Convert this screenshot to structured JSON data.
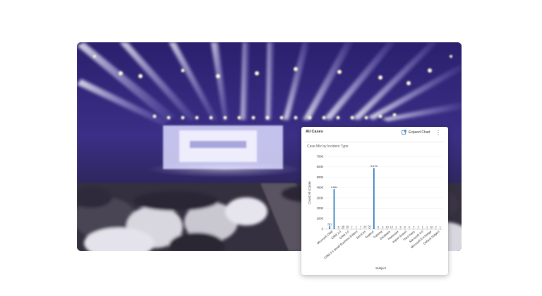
{
  "card": {
    "title": "All Cases",
    "expand_label": "Expand Chart",
    "expand_icon": "expand-icon",
    "more_icon": "more-options-icon"
  },
  "chart_data": {
    "type": "bar",
    "title": "Case Mix by Incident Type",
    "xlabel": "Subject",
    "ylabel": "Count:All (Case)",
    "ylim": [
      0,
      7000
    ],
    "yticks": [
      0,
      1000,
      2000,
      3000,
      4000,
      5000,
      6000,
      7000
    ],
    "categories": [
      "Microsoft CRM",
      "CRM 2.0",
      "CRM 3.0",
      "CRM 3.0 Small Business Edition",
      "Services",
      "Support",
      "Training",
      "Database",
      "Hardware",
      "Import Export",
      "Third Party",
      "Microsoft 4.0",
      "Microsoft Exchange",
      "Default Subject"
    ],
    "values": [
      281,
      3854,
      6,
      49,
      25,
      7,
      1,
      7,
      20,
      53,
      5876,
      6,
      3,
      10,
      12,
      1,
      3,
      6,
      4,
      2,
      2,
      1,
      1,
      10,
      2,
      1
    ],
    "value_labels": [
      "281",
      "3,854",
      "6",
      "49",
      "25",
      "7",
      "1",
      "7",
      "20",
      "53",
      "5,876",
      "6",
      "3",
      "10",
      "12",
      "1",
      "3",
      "6",
      "4",
      "2",
      "2",
      "1",
      "1",
      "10",
      "2",
      "1"
    ],
    "bar_color": "#1e6fba"
  },
  "colors": {
    "accent": "#1e6fba",
    "photo_base": "#1a1540"
  }
}
